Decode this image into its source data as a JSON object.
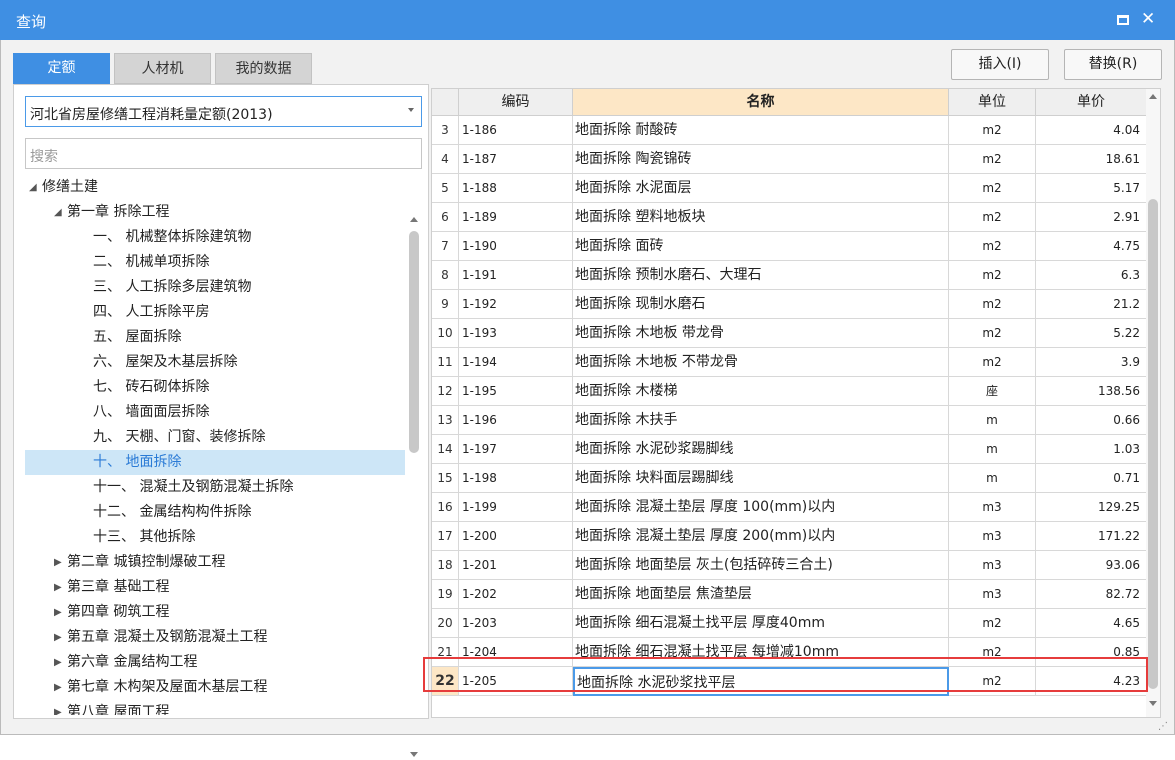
{
  "window": {
    "title": "查询"
  },
  "tabs": [
    {
      "label": "定额",
      "active": true
    },
    {
      "label": "人材机",
      "active": false
    },
    {
      "label": "我的数据",
      "active": false
    }
  ],
  "buttons": {
    "insert": "插入(I)",
    "replace": "替换(R)"
  },
  "left": {
    "select_value": "河北省房屋修缮工程消耗量定额(2013)",
    "search_placeholder": "搜索",
    "tree": [
      {
        "label": "修缮土建",
        "toggle": "◢",
        "level": 0
      },
      {
        "label": "第一章 拆除工程",
        "toggle": "◢",
        "level": 1
      },
      {
        "label": "一、 机械整体拆除建筑物",
        "toggle": "",
        "level": 2
      },
      {
        "label": "二、 机械单项拆除",
        "toggle": "",
        "level": 2
      },
      {
        "label": "三、 人工拆除多层建筑物",
        "toggle": "",
        "level": 2
      },
      {
        "label": "四、 人工拆除平房",
        "toggle": "",
        "level": 2
      },
      {
        "label": "五、 屋面拆除",
        "toggle": "",
        "level": 2
      },
      {
        "label": "六、 屋架及木基层拆除",
        "toggle": "",
        "level": 2
      },
      {
        "label": "七、 砖石砌体拆除",
        "toggle": "",
        "level": 2
      },
      {
        "label": "八、 墙面面层拆除",
        "toggle": "",
        "level": 2
      },
      {
        "label": "九、 天棚、门窗、装修拆除",
        "toggle": "",
        "level": 2
      },
      {
        "label": "十、 地面拆除",
        "toggle": "",
        "level": 2,
        "selected": true
      },
      {
        "label": "十一、 混凝土及钢筋混凝土拆除",
        "toggle": "",
        "level": 2
      },
      {
        "label": "十二、 金属结构构件拆除",
        "toggle": "",
        "level": 2
      },
      {
        "label": "十三、 其他拆除",
        "toggle": "",
        "level": 2
      },
      {
        "label": "第二章 城镇控制爆破工程",
        "toggle": "▶",
        "level": 1
      },
      {
        "label": "第三章 基础工程",
        "toggle": "▶",
        "level": 1
      },
      {
        "label": "第四章 砌筑工程",
        "toggle": "▶",
        "level": 1
      },
      {
        "label": "第五章 混凝土及钢筋混凝土工程",
        "toggle": "▶",
        "level": 1
      },
      {
        "label": "第六章 金属结构工程",
        "toggle": "▶",
        "level": 1
      },
      {
        "label": "第七章 木构架及屋面木基层工程",
        "toggle": "▶",
        "level": 1
      },
      {
        "label": "第八章 屋面工程",
        "toggle": "▶",
        "level": 1
      }
    ]
  },
  "table": {
    "headers": {
      "code": "编码",
      "name": "名称",
      "unit": "单位",
      "price": "单价"
    },
    "rows": [
      {
        "num": "3",
        "code": "1-186",
        "name": "地面拆除 耐酸砖",
        "unit": "m2",
        "price": "4.04"
      },
      {
        "num": "4",
        "code": "1-187",
        "name": "地面拆除 陶瓷锦砖",
        "unit": "m2",
        "price": "18.61"
      },
      {
        "num": "5",
        "code": "1-188",
        "name": "地面拆除 水泥面层",
        "unit": "m2",
        "price": "5.17"
      },
      {
        "num": "6",
        "code": "1-189",
        "name": "地面拆除 塑料地板块",
        "unit": "m2",
        "price": "2.91"
      },
      {
        "num": "7",
        "code": "1-190",
        "name": "地面拆除 面砖",
        "unit": "m2",
        "price": "4.75"
      },
      {
        "num": "8",
        "code": "1-191",
        "name": "地面拆除 预制水磨石、大理石",
        "unit": "m2",
        "price": "6.3"
      },
      {
        "num": "9",
        "code": "1-192",
        "name": "地面拆除 现制水磨石",
        "unit": "m2",
        "price": "21.2"
      },
      {
        "num": "10",
        "code": "1-193",
        "name": "地面拆除 木地板 带龙骨",
        "unit": "m2",
        "price": "5.22"
      },
      {
        "num": "11",
        "code": "1-194",
        "name": "地面拆除 木地板 不带龙骨",
        "unit": "m2",
        "price": "3.9"
      },
      {
        "num": "12",
        "code": "1-195",
        "name": "地面拆除 木楼梯",
        "unit": "座",
        "price": "138.56"
      },
      {
        "num": "13",
        "code": "1-196",
        "name": "地面拆除 木扶手",
        "unit": "m",
        "price": "0.66"
      },
      {
        "num": "14",
        "code": "1-197",
        "name": "地面拆除 水泥砂浆踢脚线",
        "unit": "m",
        "price": "1.03"
      },
      {
        "num": "15",
        "code": "1-198",
        "name": "地面拆除 块料面层踢脚线",
        "unit": "m",
        "price": "0.71"
      },
      {
        "num": "16",
        "code": "1-199",
        "name": "地面拆除 混凝土垫层 厚度 100(mm)以内",
        "unit": "m3",
        "price": "129.25"
      },
      {
        "num": "17",
        "code": "1-200",
        "name": "地面拆除 混凝土垫层 厚度 200(mm)以内",
        "unit": "m3",
        "price": "171.22"
      },
      {
        "num": "18",
        "code": "1-201",
        "name": "地面拆除 地面垫层 灰土(包括碎砖三合土)",
        "unit": "m3",
        "price": "93.06"
      },
      {
        "num": "19",
        "code": "1-202",
        "name": "地面拆除 地面垫层 焦渣垫层",
        "unit": "m3",
        "price": "82.72"
      },
      {
        "num": "20",
        "code": "1-203",
        "name": "地面拆除 细石混凝土找平层 厚度40mm",
        "unit": "m2",
        "price": "4.65"
      },
      {
        "num": "21",
        "code": "1-204",
        "name": "地面拆除 细石混凝土找平层 每增减10mm",
        "unit": "m2",
        "price": "0.85"
      },
      {
        "num": "22",
        "code": "1-205",
        "name": "地面拆除 水泥砂浆找平层",
        "unit": "m2",
        "price": "4.23",
        "selected": true
      }
    ]
  }
}
